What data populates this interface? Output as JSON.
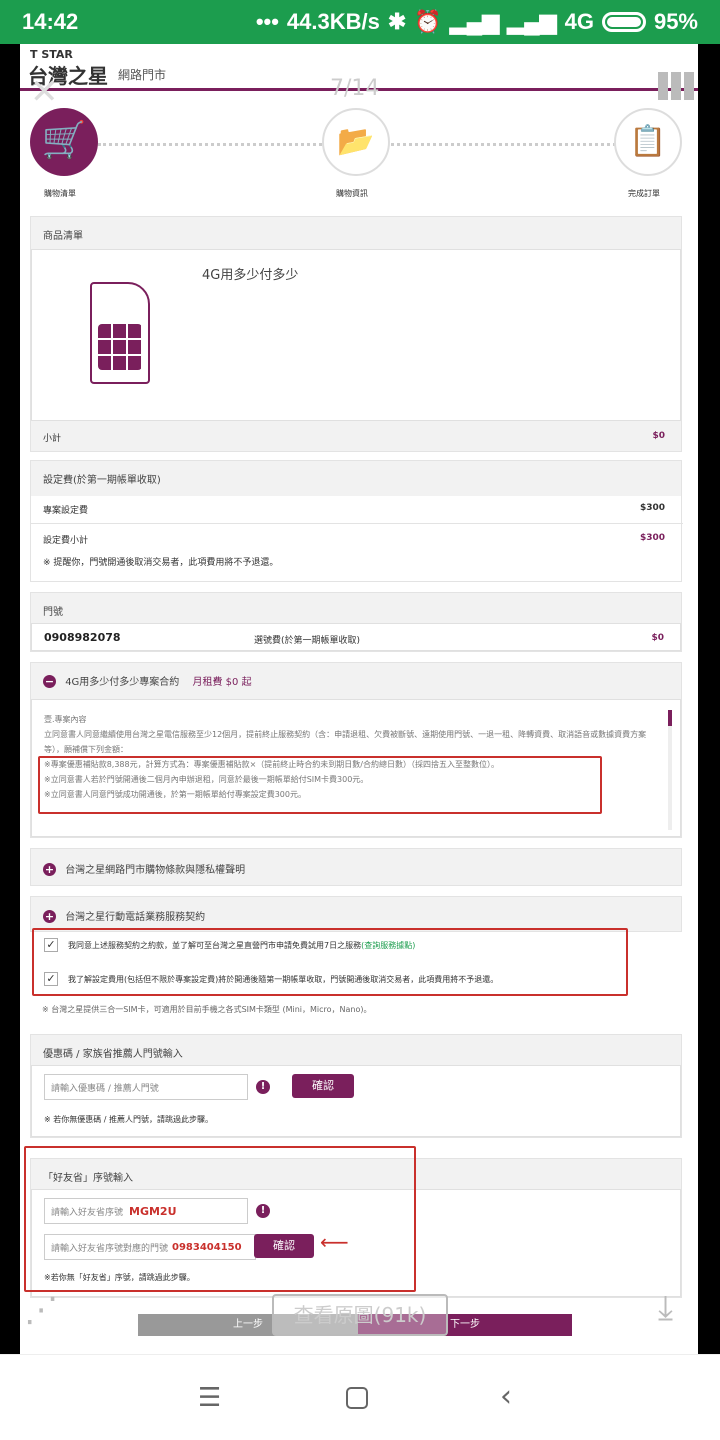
{
  "status": {
    "time": "14:42",
    "network_speed": "44.3KB/s",
    "network_type": "4G",
    "battery": "95%"
  },
  "header": {
    "brand_top": "T STAR",
    "brand_main": "台灣之星",
    "brand_sub": "網路門市",
    "page_counter": "7/14"
  },
  "steps": [
    {
      "label": "購物清單",
      "icon": "cart-icon"
    },
    {
      "label": "購物資訊",
      "icon": "folder-icon"
    },
    {
      "label": "完成訂單",
      "icon": "clipboard-icon"
    }
  ],
  "product": {
    "section_title": "商品清單",
    "name": "4G用多少付多少",
    "subtotal_label": "小計",
    "subtotal_value": "$0"
  },
  "setup_fee": {
    "section_title": "設定費(於第一期帳單收取)",
    "item_label": "專案設定費",
    "item_value": "$300",
    "subtotal_label": "設定費小計",
    "subtotal_value": "$300",
    "note": "※ 提醒你，門號開通後取消交易者，此項費用將不予退還。"
  },
  "number": {
    "section_title": "門號",
    "value": "0908982078",
    "fee_label": "選號費(於第一期帳單收取)",
    "fee_value": "$0"
  },
  "contract": {
    "title": "4G用多少付多少專案合約",
    "monthly": "月租費 $0 起",
    "heading": "壹.專案內容",
    "p1": "立同意書人同意繼續使用台灣之星電信服務至少12個月，提前終止服務契約（含：申請退租、欠費被斷號、遠期使用門號、一退一租、降轉資費、取消語音或數據資費方案等），願補償下列金額：",
    "p2": "※專案優惠補貼款8,388元，計算方式為：專案優惠補貼款×（提前終止時合約未到期日數/合約總日數）（採四捨五入至整數位）。",
    "p3": "※立同意書人若於門號開通後二個月內申辦退租，同意於最後一期帳單給付SIM卡費300元。",
    "p4": "※立同意書人同意門號成功開通後，於第一期帳單給付專案設定費300元。"
  },
  "terms1": {
    "title": "台灣之星網路門市購物條款與隱私權聲明"
  },
  "terms2": {
    "title": "台灣之星行動電話業務服務契約",
    "check1": "我同意上述服務契約之約款，並了解可至台灣之星直營門市申請免費試用7日之服務",
    "check1_link": "(查詢服務據點)",
    "check2": "我了解設定費用(包括但不限於專案設定費)將於開通後隨第一期帳單收取，門號開通後取消交易者，此項費用將不予退還。",
    "sim_note": "※ 台灣之星提供三合一SIM卡，可適用於目前手機之各式SIM卡類型 (Mini，Micro，Nano)。"
  },
  "coupon": {
    "section_title": "優惠碼 / 家族省推薦人門號輸入",
    "placeholder": "請輸入優惠碼 / 推薦人門號",
    "confirm": "確認",
    "note": "※ 若你無優惠碼 / 推薦人門號，請跳過此步驟。"
  },
  "friend": {
    "section_title": "「好友省」序號輸入",
    "serial_label": "請輸入好友省序號",
    "serial_value": "MGM2U",
    "phone_label": "請輸入好友省序號對應的門號",
    "phone_value": "0983404150",
    "confirm": "確認",
    "note": "※若你無「好友省」序號，請跳過此步驟。"
  },
  "footer": {
    "prev": "上一步",
    "next": "下一步",
    "view_original": "查看原圖(91k)"
  },
  "colors": {
    "primary": "#7a1f5c",
    "status_bar": "#1c9d4e",
    "highlight": "#c9302c"
  }
}
